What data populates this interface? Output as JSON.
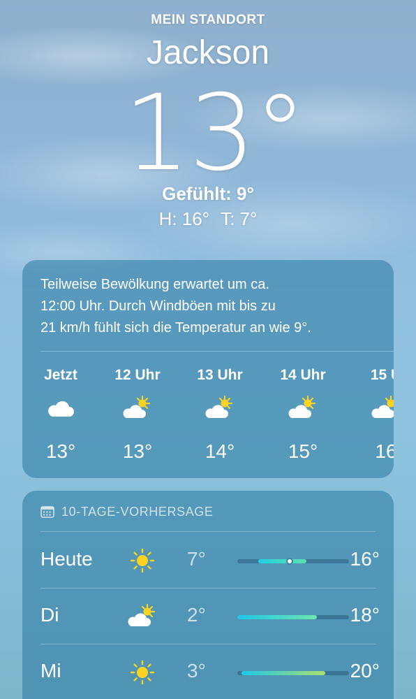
{
  "header": {
    "location_label": "MEIN STANDORT",
    "city": "Jackson",
    "temperature": "13°",
    "feels_like": "Gefühlt: 9°",
    "high": "H: 16°",
    "low": "T: 7°"
  },
  "hourly": {
    "summary_lines": [
      "Teilweise Bewölkung erwartet um ca.",
      "12:00 Uhr. Durch Windböen mit bis zu",
      "21 km/h fühlt sich die Temperatur an wie 9°."
    ],
    "hours": [
      {
        "label": "Jetzt",
        "icon": "cloud-icon",
        "temp": "13°"
      },
      {
        "label": "12 Uhr",
        "icon": "partly-sunny-icon",
        "temp": "13°"
      },
      {
        "label": "13 Uhr",
        "icon": "partly-sunny-icon",
        "temp": "14°"
      },
      {
        "label": "14 Uhr",
        "icon": "partly-sunny-icon",
        "temp": "15°"
      },
      {
        "label": "15 U",
        "icon": "partly-sunny-icon",
        "temp": "16"
      }
    ]
  },
  "forecast": {
    "title": "10-TAGE-VORHERSAGE",
    "days": [
      {
        "name": "Heute",
        "icon": "sun-icon",
        "low": "7°",
        "high": "16°",
        "range_start": 0.19,
        "range_end": 0.62,
        "current": 0.47,
        "colors": [
          "#20d0e0",
          "#5de0b0"
        ]
      },
      {
        "name": "Di",
        "icon": "partly-sunny-icon",
        "low": "2°",
        "high": "18°",
        "range_start": 0.0,
        "range_end": 0.71,
        "colors": [
          "#1cc8e8",
          "#6de6b0"
        ]
      },
      {
        "name": "Mi",
        "icon": "sun-icon",
        "low": "3°",
        "high": "20°",
        "range_start": 0.04,
        "range_end": 0.79,
        "colors": [
          "#1cc8e8",
          "#a8e070"
        ]
      }
    ]
  },
  "colors": {
    "sun": "#ffd21f",
    "card": "#2878a0"
  }
}
